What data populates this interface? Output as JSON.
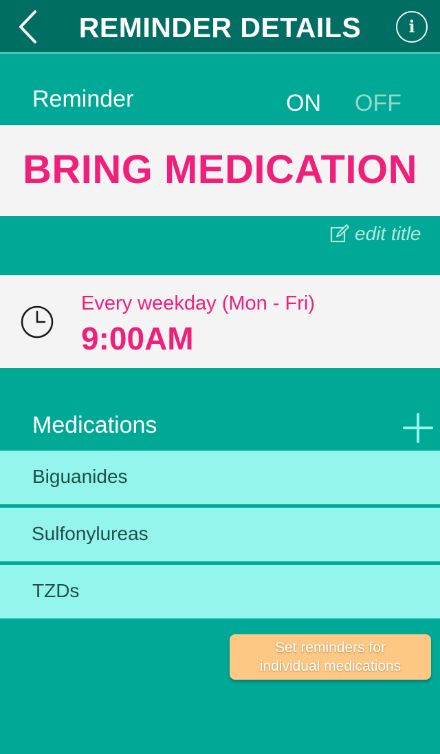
{
  "header": {
    "title": "REMINDER DETAILS",
    "back_icon": "chevron-left-icon",
    "info_icon": "info-icon",
    "info_glyph": "i"
  },
  "reminder": {
    "label": "Reminder",
    "on_label": "ON",
    "off_label": "OFF",
    "state": "ON",
    "title": "BRING MEDICATION",
    "edit_label": "edit title",
    "edit_icon": "edit-icon"
  },
  "schedule": {
    "frequency": "Every weekday (Mon - Fri)",
    "time": "9:00AM",
    "icon": "clock-icon"
  },
  "medications": {
    "label": "Medications",
    "add_icon": "plus-icon",
    "items": [
      {
        "name": "Biguanides"
      },
      {
        "name": "Sulfonylureas"
      },
      {
        "name": "TZDs"
      }
    ]
  },
  "actions": {
    "set_reminders_line1": "Set reminders for",
    "set_reminders_line2": "individual medications"
  },
  "colors": {
    "background": "#00a896",
    "header": "#006e63",
    "accent_pink": "#ef1f7a",
    "med_item": "#93f5ec",
    "button": "#fcc884"
  }
}
